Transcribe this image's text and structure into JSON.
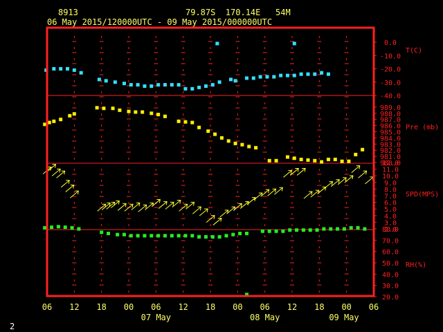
{
  "header": {
    "station_id": "8913",
    "location": "79.87S  170.14E   54M",
    "time_range": "06 May 2015/120000UTC - 09 May 2015/000000UTC",
    "page_number": "2"
  },
  "colors": {
    "frame": "#ff2020",
    "tick": "#ff2020",
    "temperature": "#33e0ff",
    "pressure": "#ffee00",
    "wind": "#ffff33",
    "humidity": "#22ee22",
    "header_text": "#ffff66"
  },
  "chart_data": {
    "type": "scatter",
    "x_axis": {
      "unit": "hours since 06 May 12 UTC",
      "range": [
        -6,
        66
      ],
      "ticks": [
        -6,
        0,
        6,
        12,
        18,
        24,
        30,
        36,
        42,
        48,
        54,
        60,
        66
      ],
      "tick_labels": [
        "06",
        "12",
        "18",
        "00",
        "06",
        "12",
        "18",
        "00",
        "06",
        "12",
        "18",
        "00",
        "06"
      ],
      "day_labels": [
        {
          "x": 18,
          "text": "07 May"
        },
        {
          "x": 42,
          "text": "08 May"
        },
        {
          "x": 66,
          "text": "09 May"
        }
      ]
    },
    "panels": [
      {
        "name": "temperature",
        "label": "T(C)",
        "ylim": [
          -40,
          0
        ],
        "ticks": [
          0,
          -10,
          -20,
          -30,
          -40
        ],
        "tick_labels": [
          "0.0",
          "-10.0",
          "-20.0",
          "-30.0",
          "-40.0"
        ],
        "points": [
          [
            -6.2,
            -21
          ],
          [
            -4.5,
            -20
          ],
          [
            -3,
            -20
          ],
          [
            -1.5,
            -20
          ],
          [
            0,
            -21
          ],
          [
            1.5,
            -23
          ],
          [
            5.5,
            -28
          ],
          [
            7,
            -29
          ],
          [
            9,
            -30
          ],
          [
            11,
            -31
          ],
          [
            12.5,
            -32
          ],
          [
            14,
            -32
          ],
          [
            15.5,
            -33
          ],
          [
            17,
            -33
          ],
          [
            18.5,
            -32
          ],
          [
            20,
            -32
          ],
          [
            21.5,
            -32
          ],
          [
            23,
            -32
          ],
          [
            24.5,
            -35
          ],
          [
            26,
            -35
          ],
          [
            27.5,
            -34
          ],
          [
            29,
            -33
          ],
          [
            30.5,
            -32
          ],
          [
            32,
            -30
          ],
          [
            34.5,
            -28
          ],
          [
            35.5,
            -29
          ],
          [
            38,
            -27
          ],
          [
            39.5,
            -27
          ],
          [
            41,
            -26
          ],
          [
            42.5,
            -26
          ],
          [
            44,
            -26
          ],
          [
            45.5,
            -25
          ],
          [
            47,
            -25
          ],
          [
            48.5,
            -25
          ],
          [
            50,
            -24
          ],
          [
            51.5,
            -24
          ],
          [
            53,
            -24
          ],
          [
            54.5,
            -23
          ],
          [
            56,
            -24
          ],
          [
            31.5,
            -1
          ],
          [
            48.5,
            -1
          ]
        ]
      },
      {
        "name": "pressure",
        "label": "Pre (mb)",
        "ylim": [
          980,
          990
        ],
        "ticks": [
          989,
          988,
          987,
          986,
          985,
          984,
          983,
          982,
          981,
          980
        ],
        "tick_labels": [
          "989.0",
          "988.0",
          "987.0",
          "986.0",
          "985.0",
          "984.0",
          "983.0",
          "982.0",
          "981.0",
          "980.0"
        ],
        "points": [
          [
            -6.5,
            986.2
          ],
          [
            -5.5,
            986.5
          ],
          [
            -4.5,
            986.7
          ],
          [
            -3,
            987
          ],
          [
            -1,
            987.6
          ],
          [
            0,
            987.9
          ],
          [
            5,
            988.9
          ],
          [
            6.5,
            988.8
          ],
          [
            8.5,
            988.8
          ],
          [
            10,
            988.5
          ],
          [
            12,
            988.3
          ],
          [
            13.5,
            988.2
          ],
          [
            15,
            988.2
          ],
          [
            17,
            988
          ],
          [
            18.5,
            987.8
          ],
          [
            20,
            987.5
          ],
          [
            23,
            986.7
          ],
          [
            24.5,
            986.6
          ],
          [
            26,
            986.5
          ],
          [
            27.5,
            985.7
          ],
          [
            29.5,
            985.1
          ],
          [
            31,
            984.6
          ],
          [
            32.5,
            984
          ],
          [
            34,
            983.5
          ],
          [
            35.5,
            983.1
          ],
          [
            37,
            982.9
          ],
          [
            38.5,
            982.6
          ],
          [
            40,
            982.4
          ],
          [
            43,
            980.3
          ],
          [
            44.5,
            980.3
          ],
          [
            47,
            980.9
          ],
          [
            48.5,
            980.7
          ],
          [
            50,
            980.5
          ],
          [
            51.5,
            980.4
          ],
          [
            53,
            980.3
          ],
          [
            54.5,
            980.1
          ],
          [
            56,
            980.5
          ],
          [
            57.5,
            980.5
          ],
          [
            59,
            980.2
          ],
          [
            60.5,
            980.2
          ],
          [
            62,
            981.3
          ],
          [
            63.5,
            982.1
          ]
        ]
      },
      {
        "name": "wind",
        "label": "SPD(MPS)",
        "ylim": [
          2,
          12
        ],
        "ticks": [
          12,
          11,
          10,
          9,
          8,
          7,
          6,
          5,
          4,
          3,
          2
        ],
        "tick_labels": [
          "12.0",
          "11.0",
          "10.0",
          "9.0",
          "8.0",
          "7.0",
          "6.0",
          "5.0",
          "4.0",
          "3.0",
          "2.0"
        ],
        "points": [
          [
            -6,
            10.8
          ],
          [
            -5,
            11.2
          ],
          [
            -4,
            10.5
          ],
          [
            -3,
            10.2
          ],
          [
            -2,
            8.8
          ],
          [
            -1,
            8.1
          ],
          [
            0,
            7.2
          ],
          [
            6,
            5.2
          ],
          [
            7,
            5.4
          ],
          [
            8,
            5.5
          ],
          [
            9,
            5.7
          ],
          [
            10.5,
            5.3
          ],
          [
            12,
            5.2
          ],
          [
            13.5,
            5.4
          ],
          [
            15,
            5.1
          ],
          [
            16.5,
            5.4
          ],
          [
            18,
            5.9
          ],
          [
            19.5,
            5.6
          ],
          [
            21,
            5.5
          ],
          [
            22.5,
            5.8
          ],
          [
            24,
            5.2
          ],
          [
            25.5,
            5.5
          ],
          [
            27,
            4.8
          ],
          [
            28.5,
            4.5
          ],
          [
            30,
            3.5
          ],
          [
            31.5,
            3.1
          ],
          [
            33,
            4.3
          ],
          [
            34.5,
            4.8
          ],
          [
            36,
            5.3
          ],
          [
            37.5,
            5.6
          ],
          [
            39,
            6.2
          ],
          [
            40.5,
            6.9
          ],
          [
            42,
            7.4
          ],
          [
            43.5,
            7.5
          ],
          [
            45,
            7.7
          ],
          [
            47,
            10.3
          ],
          [
            48.5,
            10.6
          ],
          [
            50,
            10.6
          ],
          [
            51.5,
            7.1
          ],
          [
            53,
            7.3
          ],
          [
            54.5,
            7.8
          ],
          [
            56,
            8.6
          ],
          [
            57.5,
            8.9
          ],
          [
            59,
            9.2
          ],
          [
            60.5,
            9.5
          ],
          [
            62,
            11
          ],
          [
            63.5,
            10.2
          ],
          [
            65,
            9.3
          ]
        ]
      },
      {
        "name": "humidity",
        "label": "RH(%)",
        "ylim": [
          20,
          80
        ],
        "ticks": [
          80,
          70,
          60,
          50,
          40,
          30,
          20
        ],
        "tick_labels": [
          "80.0",
          "70.0",
          "60.0",
          "50.0",
          "40.0",
          "30.0",
          "20.0"
        ],
        "points": [
          [
            -6.5,
            81
          ],
          [
            -5,
            81.5
          ],
          [
            -3.5,
            82
          ],
          [
            -2,
            81.5
          ],
          [
            -0.5,
            81
          ],
          [
            1,
            80
          ],
          [
            6,
            77
          ],
          [
            7.5,
            76
          ],
          [
            9.5,
            75
          ],
          [
            11,
            75
          ],
          [
            12.5,
            74
          ],
          [
            14,
            74
          ],
          [
            15.5,
            74
          ],
          [
            17,
            74
          ],
          [
            18.5,
            74
          ],
          [
            20,
            74
          ],
          [
            21.5,
            74
          ],
          [
            23,
            74
          ],
          [
            24.5,
            74
          ],
          [
            26,
            74
          ],
          [
            27.5,
            73
          ],
          [
            29,
            73
          ],
          [
            30.5,
            73
          ],
          [
            32,
            73
          ],
          [
            33.5,
            74
          ],
          [
            35,
            75
          ],
          [
            36.5,
            76
          ],
          [
            38,
            76
          ],
          [
            41.5,
            78
          ],
          [
            43,
            78
          ],
          [
            44.5,
            78
          ],
          [
            46,
            78
          ],
          [
            47.5,
            79
          ],
          [
            49,
            79
          ],
          [
            50.5,
            79
          ],
          [
            52,
            79
          ],
          [
            53.5,
            79
          ],
          [
            55,
            80
          ],
          [
            56.5,
            80
          ],
          [
            58,
            80
          ],
          [
            59.5,
            80
          ],
          [
            61,
            81
          ],
          [
            62.5,
            81
          ],
          [
            64,
            80
          ],
          [
            38,
            22
          ]
        ]
      }
    ]
  }
}
